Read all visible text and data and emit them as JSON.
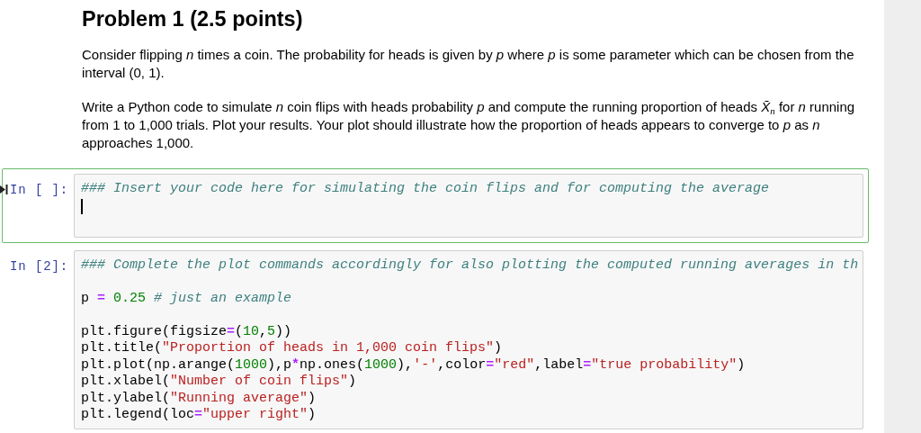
{
  "cells": [
    {
      "kind": "markdown",
      "heading": "Problem 1 (2.5 points)",
      "paragraphs": [
        "Consider flipping *n* times a coin. The probability for heads is given by *p* where *p* is some parameter which can be chosen from the interval (0, 1).",
        "Write a Python code to simulate *n* coin flips with heads probability *p* and compute the running proportion of heads *X̄*$_{n}$ for *n* running from 1 to 1,000 trials. Plot your results. Your plot should illustrate how the proportion of heads appears to converge to *p* as *n* approaches 1,000."
      ]
    },
    {
      "kind": "code",
      "prompt": "In [ ]:",
      "selected": true,
      "editing": true,
      "blocks": [
        [
          [
            {
              "kind": "comment",
              "text": "### Insert your code here for simulating the coin flips and for computing the average"
            }
          ]
        ]
      ]
    },
    {
      "kind": "code",
      "prompt": "In [2]:",
      "selected": false,
      "editing": false,
      "blocks": [
        [
          [
            {
              "kind": "comment",
              "text": "### Complete the plot commands accordingly for also plotting the computed running averages in th"
            }
          ]
        ],
        [
          [
            {
              "kind": "plain",
              "text": "p "
            },
            {
              "kind": "operator",
              "text": "="
            },
            {
              "kind": "number",
              "text": " 0.25"
            },
            {
              "kind": "comment",
              "text": " # just an example"
            }
          ]
        ],
        [
          [
            {
              "kind": "plain",
              "text": "plt.figure(figsize"
            },
            {
              "kind": "operator",
              "text": "="
            },
            {
              "kind": "plain",
              "text": "("
            },
            {
              "kind": "number",
              "text": "10"
            },
            {
              "kind": "plain",
              "text": ","
            },
            {
              "kind": "number",
              "text": "5"
            },
            {
              "kind": "plain",
              "text": "))"
            }
          ],
          [
            {
              "kind": "plain",
              "text": "plt.title("
            },
            {
              "kind": "string",
              "text": "\"Proportion of heads in 1,000 coin flips\""
            },
            {
              "kind": "plain",
              "text": ")"
            }
          ],
          [
            {
              "kind": "plain",
              "text": "plt.plot(np.arange("
            },
            {
              "kind": "number",
              "text": "1000"
            },
            {
              "kind": "plain",
              "text": "),p"
            },
            {
              "kind": "operator",
              "text": "*"
            },
            {
              "kind": "plain",
              "text": "np.ones("
            },
            {
              "kind": "number",
              "text": "1000"
            },
            {
              "kind": "plain",
              "text": "),"
            },
            {
              "kind": "string",
              "text": "'-'"
            },
            {
              "kind": "plain",
              "text": ",color"
            },
            {
              "kind": "operator",
              "text": "="
            },
            {
              "kind": "string",
              "text": "\"red\""
            },
            {
              "kind": "plain",
              "text": ",label"
            },
            {
              "kind": "operator",
              "text": "="
            },
            {
              "kind": "string",
              "text": "\"true probability\""
            },
            {
              "kind": "plain",
              "text": ")"
            }
          ],
          [
            {
              "kind": "plain",
              "text": "plt.xlabel("
            },
            {
              "kind": "string",
              "text": "\"Number of coin flips\""
            },
            {
              "kind": "plain",
              "text": ")"
            }
          ],
          [
            {
              "kind": "plain",
              "text": "plt.ylabel("
            },
            {
              "kind": "string",
              "text": "\"Running average\""
            },
            {
              "kind": "plain",
              "text": ")"
            }
          ],
          [
            {
              "kind": "plain",
              "text": "plt.legend(loc"
            },
            {
              "kind": "operator",
              "text": "="
            },
            {
              "kind": "string",
              "text": "\"upper right\""
            },
            {
              "kind": "plain",
              "text": ")"
            }
          ]
        ]
      ]
    }
  ]
}
